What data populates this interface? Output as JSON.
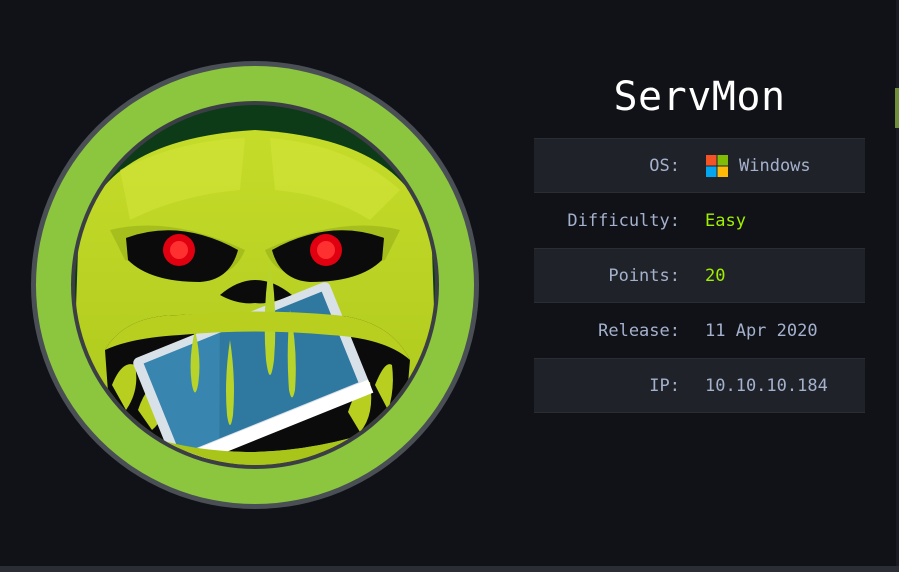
{
  "machine": {
    "name": "ServMon"
  },
  "info": [
    {
      "label": "OS:",
      "value": "Windows",
      "icon": "windows-icon",
      "value_color": "#a4b1cd"
    },
    {
      "label": "Difficulty:",
      "value": "Easy",
      "value_color": "#9fef00"
    },
    {
      "label": "Points:",
      "value": "20",
      "value_color": "#9fef00"
    },
    {
      "label": "Release:",
      "value": "11 Apr 2020",
      "value_color": "#a4b1cd"
    },
    {
      "label": "IP:",
      "value": "10.10.10.184",
      "value_color": "#a4b1cd"
    }
  ],
  "colors": {
    "background": "#111217",
    "accent_green": "#9fef00",
    "label": "#a4b1cd",
    "row_shade": "#1f2228"
  },
  "logo": {
    "icon": "slime-monster-monitor-logo"
  }
}
